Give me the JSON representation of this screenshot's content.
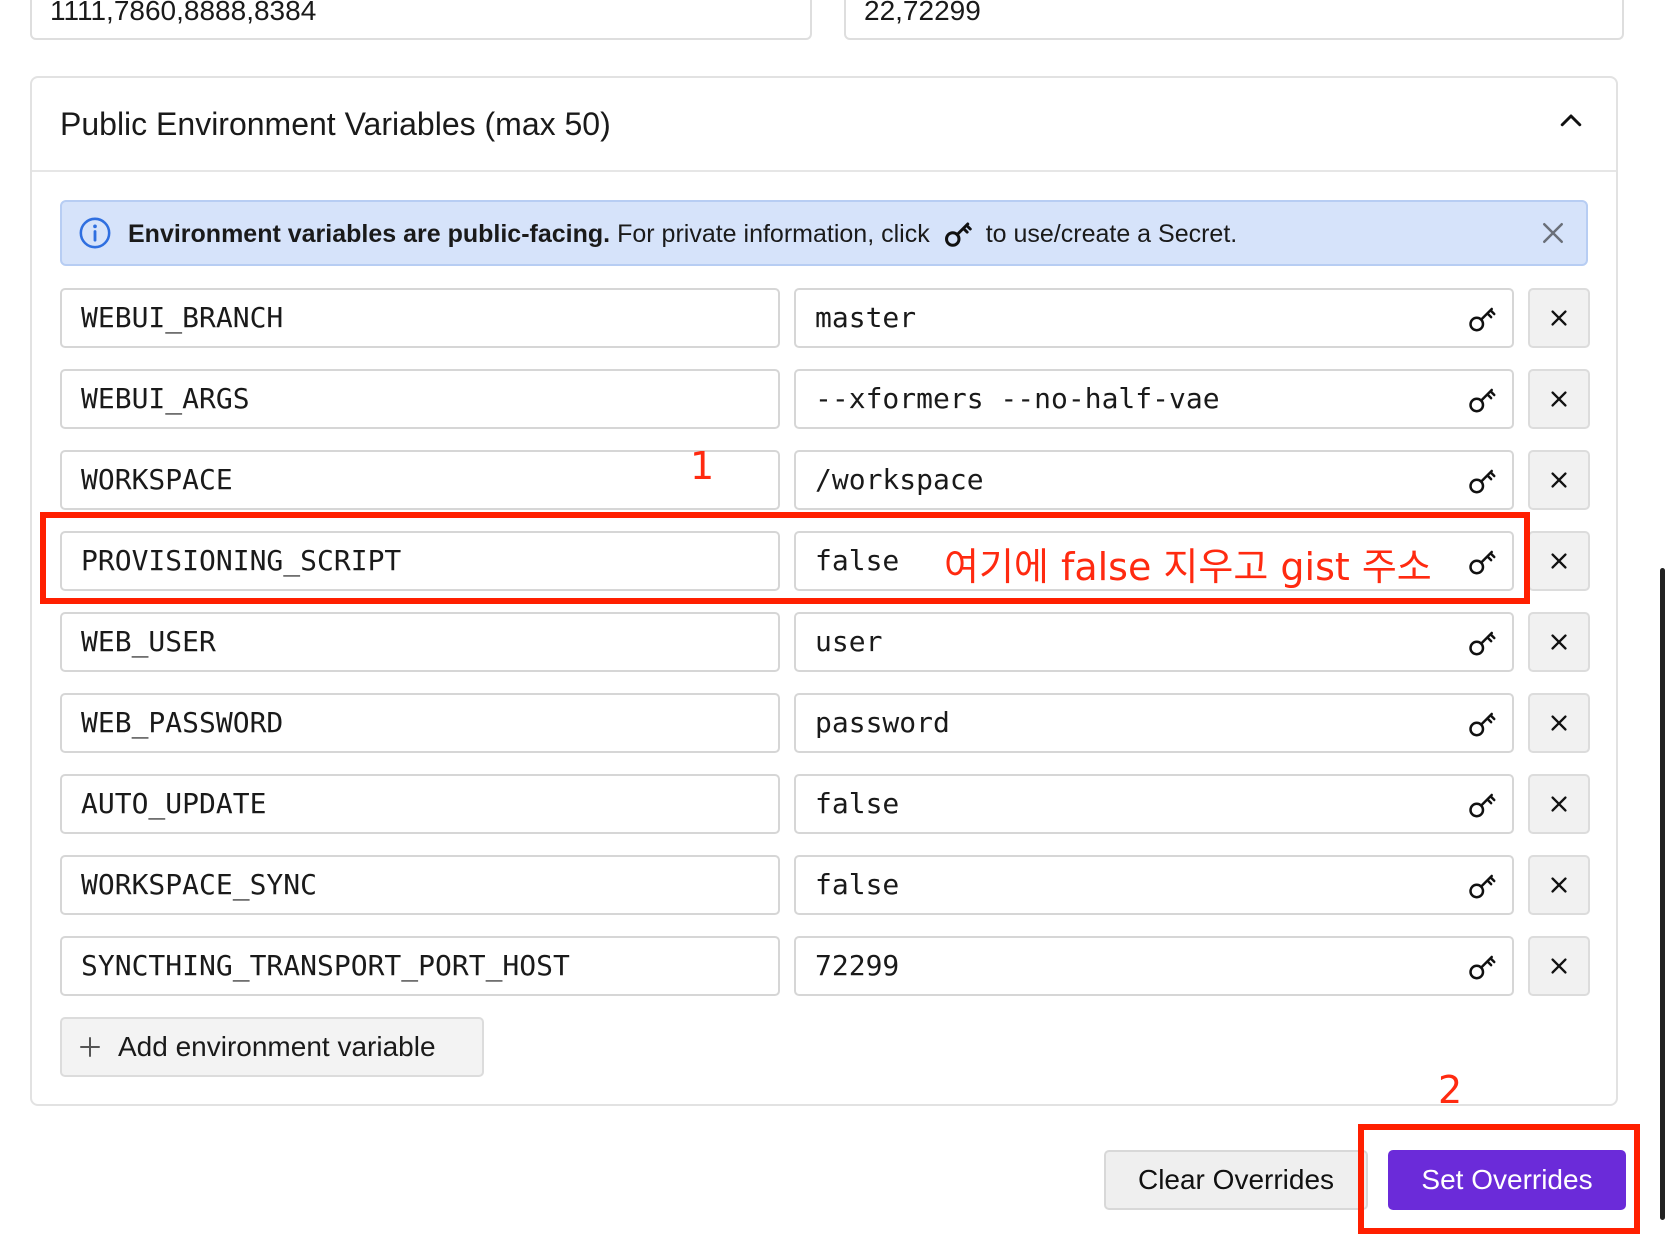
{
  "top_fields": {
    "ports": "1111,7860,8888,8384",
    "ports_right": "22,72299"
  },
  "panel": {
    "title": "Public Environment Variables (max 50)"
  },
  "banner": {
    "bold_text": "Environment variables are public-facing.",
    "text_before_icon": "For private information, click",
    "text_after_icon": "to use/create a Secret."
  },
  "env_vars": [
    {
      "key": "WEBUI_BRANCH",
      "value": "master"
    },
    {
      "key": "WEBUI_ARGS",
      "value": "--xformers --no-half-vae"
    },
    {
      "key": "WORKSPACE",
      "value": "/workspace"
    },
    {
      "key": "PROVISIONING_SCRIPT",
      "value": "false"
    },
    {
      "key": "WEB_USER",
      "value": "user"
    },
    {
      "key": "WEB_PASSWORD",
      "value": "password"
    },
    {
      "key": "AUTO_UPDATE",
      "value": "false"
    },
    {
      "key": "WORKSPACE_SYNC",
      "value": "false"
    },
    {
      "key": "SYNCTHING_TRANSPORT_PORT_HOST",
      "value": "72299"
    }
  ],
  "add_button": {
    "label": "Add environment variable"
  },
  "actions": {
    "clear": "Clear Overrides",
    "set": "Set Overrides"
  },
  "annotations": {
    "step1": "1",
    "step1_note": "여기에 false 지우고 gist 주소",
    "step2": "2"
  },
  "colors": {
    "accent": "#6b2bd9",
    "annotation": "#ff1f00",
    "banner_bg": "#d6e3fa"
  }
}
